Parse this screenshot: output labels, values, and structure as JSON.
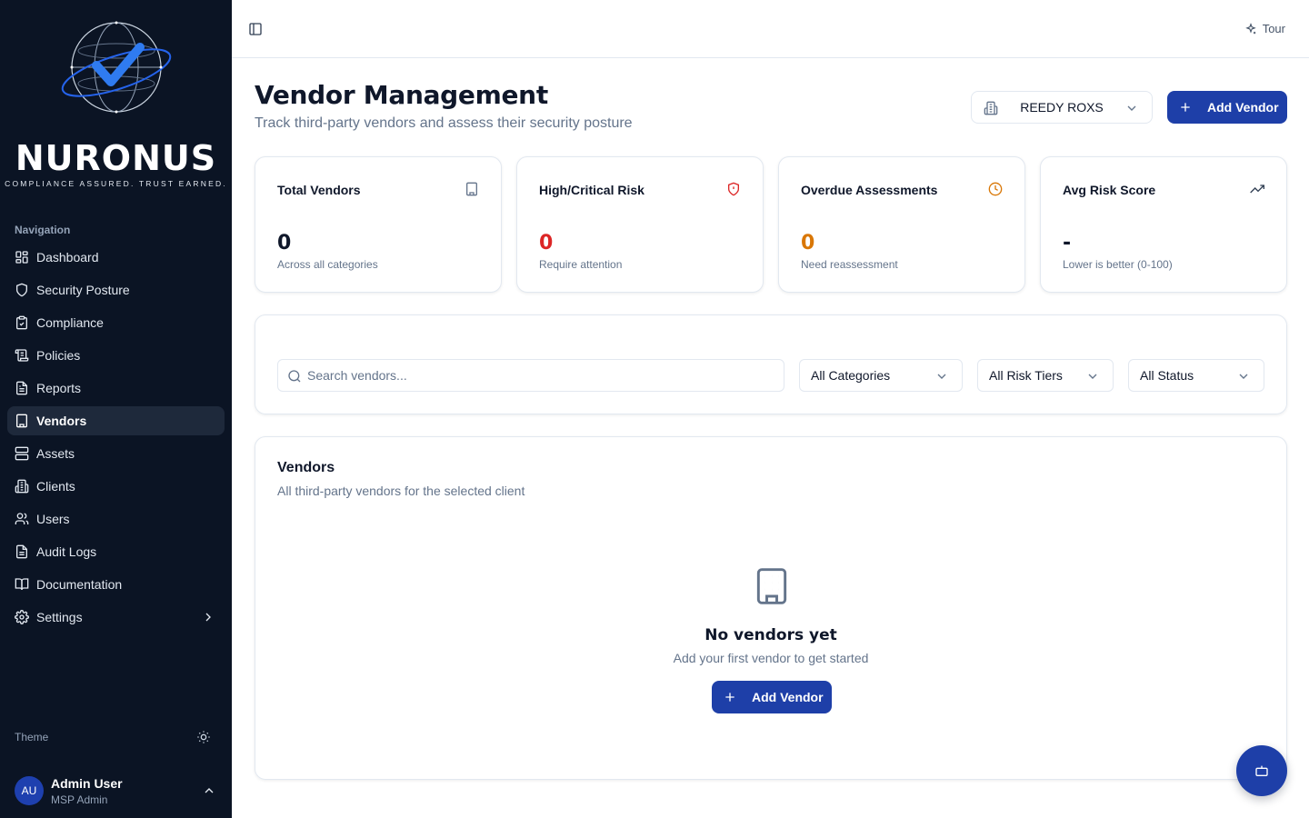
{
  "brand": {
    "name": "NURONUS",
    "tagline": "COMPLIANCE ASSURED. TRUST EARNED.",
    "logo_icon": "globe-check-icon"
  },
  "sidebar": {
    "heading": "Navigation",
    "items": [
      {
        "label": "Dashboard",
        "icon": "dashboard-icon"
      },
      {
        "label": "Security Posture",
        "icon": "shield-icon"
      },
      {
        "label": "Compliance",
        "icon": "clipboard-check-icon"
      },
      {
        "label": "Policies",
        "icon": "scroll-icon"
      },
      {
        "label": "Reports",
        "icon": "file-text-icon"
      },
      {
        "label": "Vendors",
        "icon": "building-icon",
        "active": true
      },
      {
        "label": "Assets",
        "icon": "server-icon"
      },
      {
        "label": "Clients",
        "icon": "buildings-icon"
      },
      {
        "label": "Users",
        "icon": "users-icon"
      },
      {
        "label": "Audit Logs",
        "icon": "file-list-icon"
      },
      {
        "label": "Documentation",
        "icon": "book-open-icon"
      },
      {
        "label": "Settings",
        "icon": "gear-icon"
      }
    ],
    "theme_label": "Theme",
    "user": {
      "initials": "AU",
      "name": "Admin User",
      "role": "MSP Admin"
    }
  },
  "topbar": {
    "tour_label": "Tour"
  },
  "header": {
    "title": "Vendor Management",
    "subtitle": "Track third-party vendors and assess their security posture",
    "client_select": "REEDY ROXS",
    "add_button": "Add Vendor"
  },
  "stats": [
    {
      "label": "Total Vendors",
      "value": "0",
      "note": "Across all categories",
      "icon": "building-icon",
      "color": "#0f172a"
    },
    {
      "label": "High/Critical Risk",
      "value": "0",
      "note": "Require attention",
      "icon": "shield-alert-icon",
      "color": "#dc2626"
    },
    {
      "label": "Overdue Assessments",
      "value": "0",
      "note": "Need reassessment",
      "icon": "clock-icon",
      "color": "#d97706"
    },
    {
      "label": "Avg Risk Score",
      "value": "-",
      "note": "Lower is better (0-100)",
      "icon": "trending-up-icon",
      "color": "#0f172a"
    }
  ],
  "filters": {
    "search_placeholder": "Search vendors...",
    "category": "All Categories",
    "risk_tier": "All Risk Tiers",
    "status": "All Status"
  },
  "vendors": {
    "title": "Vendors",
    "subtitle": "All third-party vendors for the selected client",
    "empty_title": "No vendors yet",
    "empty_subtitle": "Add your first vendor to get started",
    "add_button": "Add Vendor"
  },
  "colors": {
    "sidebar_bg": "#0b1424",
    "primary": "#1e3fa8",
    "danger": "#dc2626",
    "warning": "#d97706"
  }
}
